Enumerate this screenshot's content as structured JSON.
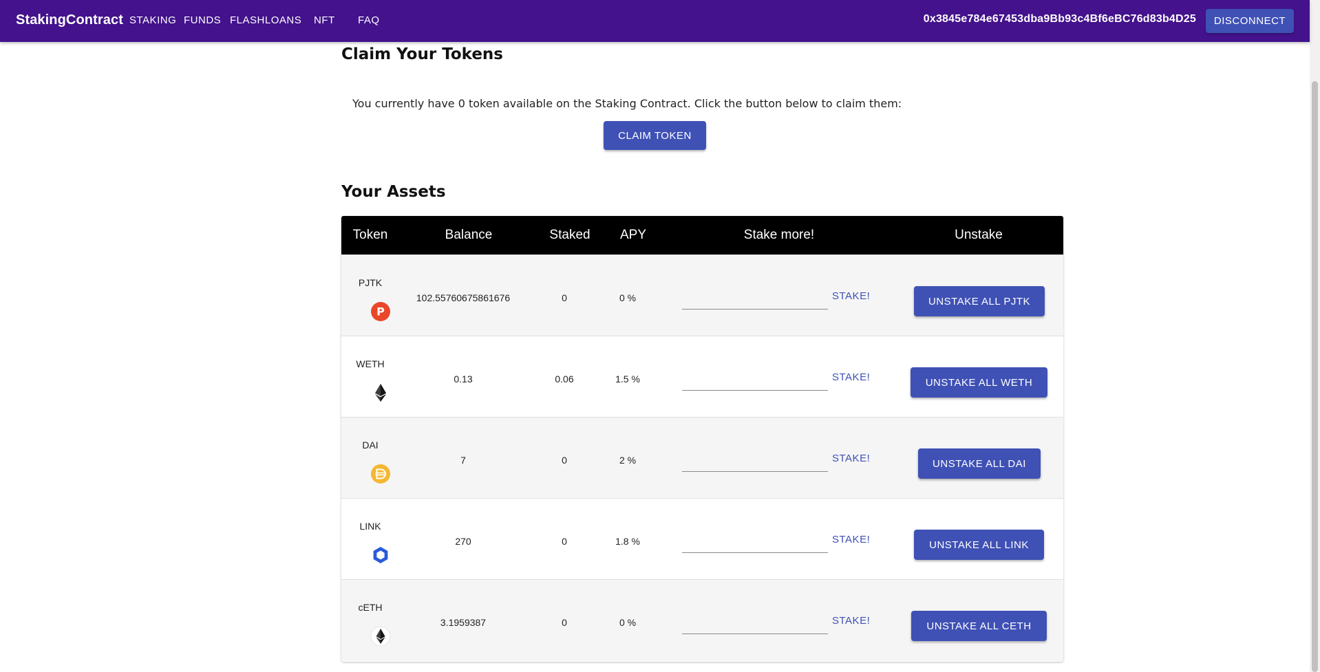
{
  "appbar": {
    "brand": "StakingContract",
    "nav": [
      "STAKING",
      "FUNDS",
      "FLASHLOANS",
      "NFT",
      "FAQ"
    ],
    "wallet_address": "0x3845e784e67453dba9Bb93c4Bf6eBC76d83b4D25",
    "disconnect_label": "DISCONNECT"
  },
  "claim": {
    "heading": "Claim Your Tokens",
    "text": "You currently have 0 token available on the Staking Contract. Click the button below to claim them:",
    "button_label": "CLAIM TOKEN"
  },
  "assets": {
    "heading": "Your Assets",
    "columns": [
      "Token",
      "Balance",
      "Staked",
      "APY",
      "Stake more!",
      "Unstake"
    ],
    "stake_link_label": "STAKE!",
    "rows": [
      {
        "symbol": "PJTK",
        "icon": "pjtk-coin-icon",
        "balance": "102.55760675861676",
        "staked": "0",
        "apy": "0 %",
        "unstake_label": "UNSTAKE ALL PJTK"
      },
      {
        "symbol": "WETH",
        "icon": "ethereum-icon",
        "balance": "0.13",
        "staked": "0.06",
        "apy": "1.5 %",
        "unstake_label": "UNSTAKE ALL WETH"
      },
      {
        "symbol": "DAI",
        "icon": "dai-coin-icon",
        "balance": "7",
        "staked": "0",
        "apy": "2 %",
        "unstake_label": "UNSTAKE ALL DAI"
      },
      {
        "symbol": "LINK",
        "icon": "chainlink-icon",
        "balance": "270",
        "staked": "0",
        "apy": "1.8 %",
        "unstake_label": "UNSTAKE ALL LINK"
      },
      {
        "symbol": "cETH",
        "icon": "ceth-coin-icon",
        "balance": "3.1959387",
        "staked": "0",
        "apy": "0 %",
        "unstake_label": "UNSTAKE ALL CETH"
      }
    ]
  },
  "colors": {
    "appbar": "#43128c",
    "primary": "#3f51b5",
    "table_header": "#000000",
    "row_alt": "#f5f5f5"
  }
}
